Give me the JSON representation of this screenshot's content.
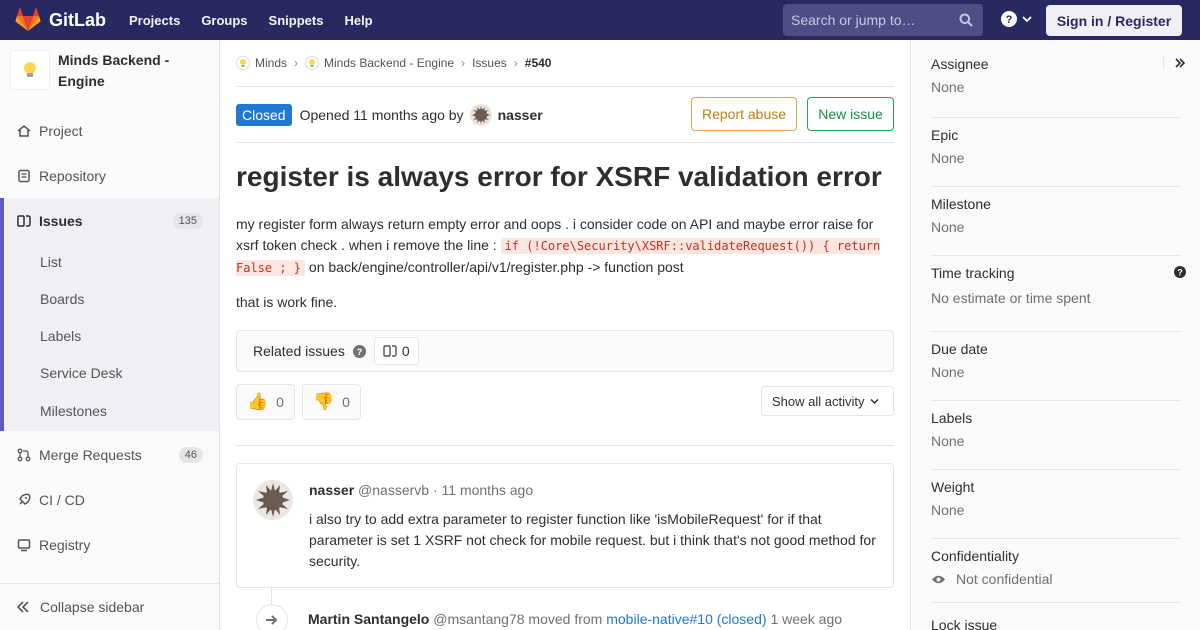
{
  "navbar": {
    "brand": "GitLab",
    "links": [
      "Projects",
      "Groups",
      "Snippets",
      "Help"
    ],
    "search_placeholder": "Search or jump to…",
    "sign_in": "Sign in / Register",
    "colors": {
      "navbar": "#292961",
      "logo_orange": "#e24329"
    }
  },
  "sidebar": {
    "project_name": "Minds Backend - Engine",
    "items": [
      {
        "label": "Project",
        "icon": "home-icon"
      },
      {
        "label": "Repository",
        "icon": "doc-icon"
      },
      {
        "label": "Issues",
        "icon": "issues-icon",
        "count": "135",
        "active": true
      },
      {
        "label": "Merge Requests",
        "icon": "merge-icon",
        "count": "46"
      },
      {
        "label": "CI / CD",
        "icon": "rocket-icon"
      },
      {
        "label": "Registry",
        "icon": "registry-icon"
      }
    ],
    "subitems": [
      "List",
      "Boards",
      "Labels",
      "Service Desk",
      "Milestones"
    ],
    "collapse": "Collapse sidebar"
  },
  "breadcrumb": {
    "group": "Minds",
    "project": "Minds Backend - Engine",
    "section": "Issues",
    "current": "#540"
  },
  "issue": {
    "status": "Closed",
    "opened_text": "Opened 11 months ago by",
    "author": "nasser",
    "report_abuse": "Report abuse",
    "new_issue": "New issue",
    "title": "register is always error for XSRF validation error",
    "desc_part1": "my register form always return empty error and oops . i consider code on API and maybe error raise for xsrf token check . when i remove the line : ",
    "desc_code": "if (!Core\\Security\\XSRF::validateRequest()) { return False ; }",
    "desc_part2": " on back/engine/controller/api/v1/register.php -> function post",
    "desc_line2": "that is work fine.",
    "related_label": "Related issues",
    "related_count": "0"
  },
  "awards": {
    "thumbs_up": "0",
    "thumbs_down": "0",
    "activity_filter": "Show all activity"
  },
  "note": {
    "author": "nasser",
    "username": "@nasservb",
    "time": "· 11 months ago",
    "body": "i also try to add extra parameter to register function like 'isMobileRequest' for if that parameter is set 1 XSRF not check for mobile request. but i think that's not good method for security."
  },
  "system_note": {
    "author": "Martin Santangelo",
    "username": "@msantang78",
    "action": "moved from",
    "link": "mobile-native#10 (closed)",
    "time": "1 week ago"
  },
  "right_sidebar": {
    "assignee_label": "Assignee",
    "assignee_value": "None",
    "epic_label": "Epic",
    "epic_value": "None",
    "milestone_label": "Milestone",
    "milestone_value": "None",
    "time_label": "Time tracking",
    "time_value": "No estimate or time spent",
    "due_label": "Due date",
    "due_value": "None",
    "labels_label": "Labels",
    "labels_value": "None",
    "weight_label": "Weight",
    "weight_value": "None",
    "conf_label": "Confidentiality",
    "conf_value": "Not confidential",
    "lock_label": "Lock issue"
  }
}
